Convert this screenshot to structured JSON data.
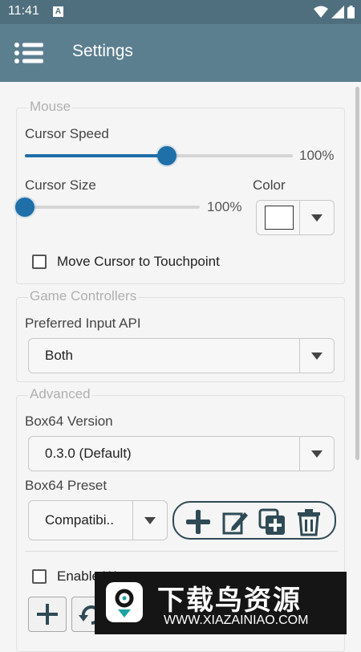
{
  "status_bar": {
    "time": "11:41",
    "notification_letter": "A"
  },
  "app_bar": {
    "title": "Settings"
  },
  "mouse": {
    "legend": "Mouse",
    "cursor_speed_label": "Cursor Speed",
    "cursor_speed_value": "100%",
    "cursor_speed_level": 0.53,
    "cursor_size_label": "Cursor Size",
    "cursor_size_value": "100%",
    "cursor_size_level": 0.0,
    "color_label": "Color",
    "color_value": "#ffffff",
    "move_cursor_label": "Move Cursor to Touchpoint",
    "move_cursor_checked": false
  },
  "game_controllers": {
    "legend": "Game Controllers",
    "preferred_api_label": "Preferred Input API",
    "preferred_api_value": "Both"
  },
  "advanced": {
    "legend": "Advanced",
    "box64_version_label": "Box64 Version",
    "box64_version_value": "0.3.0 (Default)",
    "box64_preset_label": "Box64 Preset",
    "box64_preset_value": "Compatibi..",
    "preset_toolbar": [
      "add-icon",
      "edit-icon",
      "duplicate-icon",
      "delete-icon"
    ],
    "enable_label_visible": "Enable W",
    "enable_checked": false
  },
  "watermark": {
    "title": "下载鸟资源",
    "url": "WWW.XIAZAINIAO.COM"
  },
  "colors": {
    "status_bar": "#4f6f7e",
    "app_bar": "#5c7f8f",
    "accent": "#1f6fa8",
    "toolbar_icons": "#2e4a55"
  }
}
